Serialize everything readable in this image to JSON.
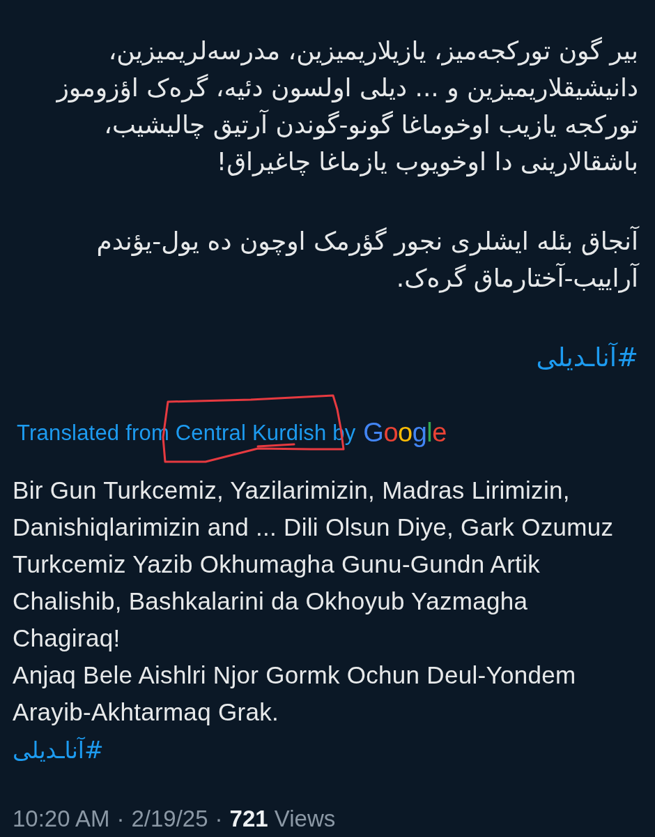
{
  "tweet": {
    "paragraphs": [
      "بیر گون تورکجه‌میز، یازیلاریمیزین، مدرسه‌لریمیزین،\nدانیشیقلاریمیزین و ... دیلی اولسون دئیه، گره‌ک اؤزوموز\nتورکجه یازیب اوخوماغا گونو-گوندن آرتیق چالیشیب،\nباشقالارینی دا اوخویوب یازماغا چاغیراق!",
      "آنجاق بئله ایشلری نجور گؤرمک اوچون ده یول-یؤندم\nآراییب-آختارماق گره‌ک."
    ],
    "hashtag": "#آناـدیلی"
  },
  "translation": {
    "label": "Translated from Central Kurdish by",
    "provider": "Google",
    "marked": true,
    "paragraphs": [
      "Bir Gun Turkcemiz, Yazilarimizin, Madras Lirimizin,\nDanishiqlarimizin and ... Dili Olsun Diye, Gark Ozumuz\nTurkcemiz Yazib Okhumagha Gunu-Gundn Artik\nChalishib, Bashkalarini da Okhoyub Yazmagha\nChagiraq!",
      "Anjaq Bele Aishlri Njor Gormk Ochun Deul-Yondem\nArayib-Akhtarmaq Grak."
    ],
    "hashtag": "#آناـدیلی"
  },
  "meta": {
    "time": "10:20 AM",
    "separator_1": "·",
    "date": "2/19/25",
    "separator_2": "·",
    "views": "**721** Views"
  }
}
